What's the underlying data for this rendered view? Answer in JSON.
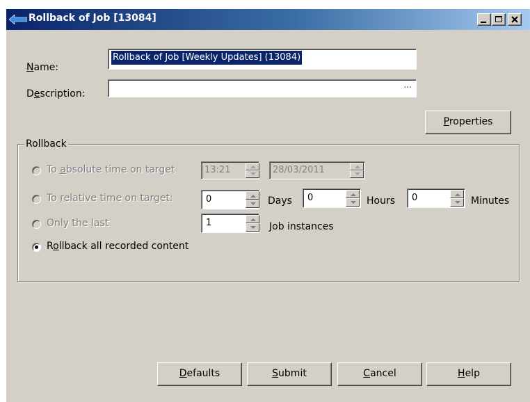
{
  "window": {
    "title": "Rollback of Job [13084]"
  },
  "form": {
    "name_label": "Name:",
    "name_value": "Rollback of Job [Weekly Updates] (13084)",
    "description_label": "Description:",
    "description_value": "",
    "description_button": "...",
    "properties_button": "Properties"
  },
  "rollback": {
    "group_title": "Rollback",
    "absolute": {
      "label": "To absolute time on target",
      "time": "13:21",
      "date": "28/03/2011"
    },
    "relative": {
      "label": "To relative time on target:",
      "days": "0",
      "days_label": "Days",
      "hours": "0",
      "hours_label": "Hours",
      "minutes": "0",
      "minutes_label": "Minutes"
    },
    "only_last": {
      "label": "Only the last",
      "count": "1",
      "unit_label": "Job instances"
    },
    "all": {
      "label": "Rollback all recorded content",
      "selected": true
    }
  },
  "buttons": {
    "defaults": "Defaults",
    "submit": "Submit",
    "cancel": "Cancel",
    "help": "Help"
  },
  "colors": {
    "face": "#d4d0c8",
    "titlebar_start": "#0a246a",
    "titlebar_end": "#a6caf0",
    "selection": "#0a246a",
    "disabled_text": "#808080"
  }
}
